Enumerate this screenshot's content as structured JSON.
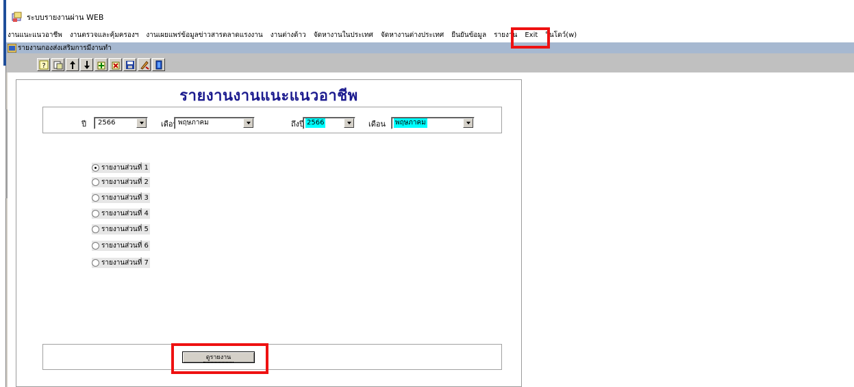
{
  "window": {
    "title": "ระบบรายงานผ่าน WEB"
  },
  "menu": {
    "items": [
      "งานแนะแนวอาชีพ",
      "งานตรวจและคุ้มครองฯ",
      "งานเผยแพร่ข้อมูลข่าวสารตลาดแรงงาน",
      "งานต่างด้าว",
      "จัดหางานในประเทศ",
      "จัดหางานต่างประเทศ",
      "ยืนยันข้อมูล",
      "รายงาน",
      "Exit",
      "วินโดว์(w)"
    ]
  },
  "subwindow": {
    "title": "รายงานกองส่งเสริมการมีงานทำ"
  },
  "toolbar": {
    "icons": [
      "help-icon",
      "print-preview-icon",
      "move-up-icon",
      "move-down-icon",
      "add-record-icon",
      "delete-record-icon",
      "save-icon",
      "edit-icon",
      "exit-door-icon"
    ]
  },
  "form": {
    "title": "รายงานงานแนะแนวอาชีพ",
    "year_label": "ปี",
    "year_value": "2566",
    "month_label": "เดือน",
    "month_value": "พฤษภาคม",
    "to_year_label": "ถึงปี",
    "to_year_value": "2566",
    "to_month_label": "เดือน",
    "to_month_value": "พฤษภาคม",
    "report_options": [
      "รายงานส่วนที่ 1",
      "รายงานส่วนที่ 2",
      "รายงานส่วนที่ 3",
      "รายงานส่วนที่ 4",
      "รายงานส่วนที่ 5",
      "รายงานส่วนที่ 6",
      "รายงานส่วนที่ 7"
    ],
    "selected_option": "รายงานส่วนที่ 1",
    "view_button": "ดูรายงาน"
  },
  "colors": {
    "title_blue": "#1b1a8e",
    "highlight_red": "#ee1111",
    "field_cyan": "#00ffff"
  }
}
